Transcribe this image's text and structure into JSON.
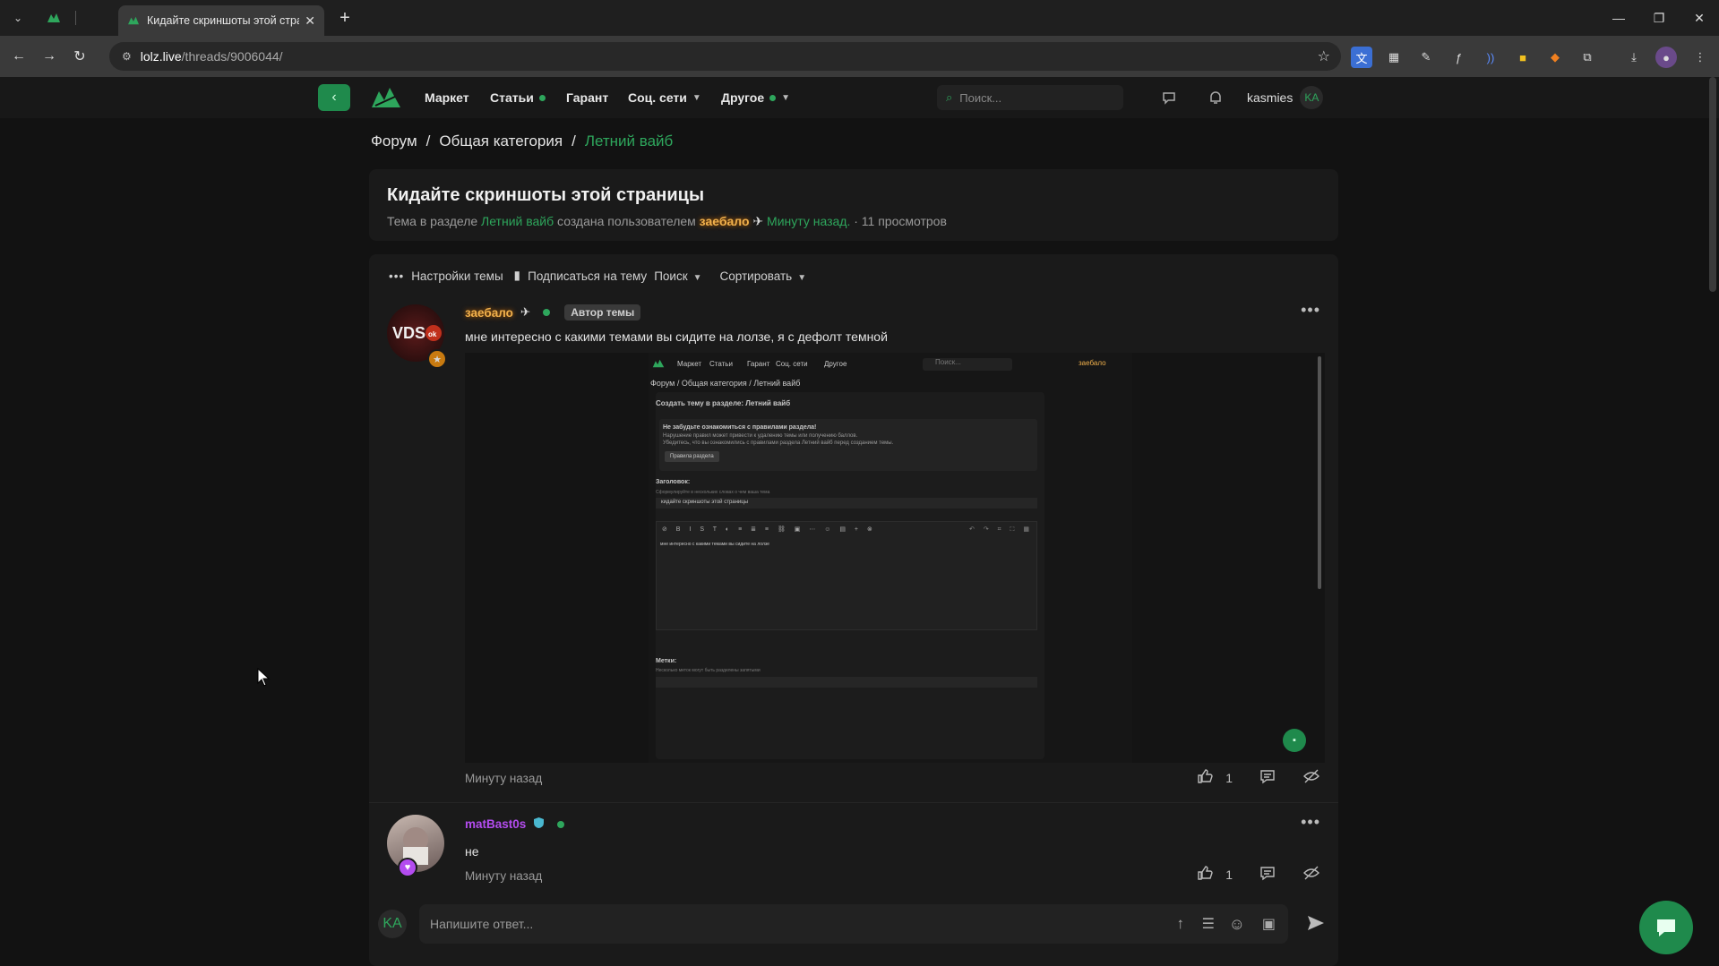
{
  "browser": {
    "tab_title": "Кидайте скриншоты этой стра",
    "url_host": "lolz.live",
    "url_path": "/threads/9006044/"
  },
  "header": {
    "nav": [
      {
        "label": "Маркет"
      },
      {
        "label": "Статьи"
      },
      {
        "label": "Гарант"
      },
      {
        "label": "Соц. сети"
      },
      {
        "label": "Другое"
      }
    ],
    "search_placeholder": "Поиск...",
    "username": "kasmies",
    "avatar_initials": "KA"
  },
  "breadcrumbs": [
    "Форум",
    "Общая категория",
    "Летний вайб"
  ],
  "thread": {
    "title": "Кидайте скриншоты этой страницы",
    "meta_prefix": "Тема в разделе",
    "section": "Летний вайб",
    "meta_mid": "создана пользователем",
    "author": "заебало",
    "time": "Минуту назад.",
    "views": "· 11 просмотров"
  },
  "toolbar": {
    "settings": "Настройки темы",
    "subscribe": "Подписаться на тему",
    "search": "Поиск",
    "sort": "Сортировать"
  },
  "posts": [
    {
      "author": "заебало",
      "tag": "Автор темы",
      "text": "мне интересно с какими темами вы сидите на лолзе, я с дефолт темной",
      "time": "Минуту назад",
      "likes": "1"
    },
    {
      "author": "matBast0s",
      "text": "не",
      "time": "Минуту назад",
      "likes": "1"
    }
  ],
  "screenshot": {
    "nav": [
      "Маркет",
      "Статьи",
      "Гарант",
      "Соц. сети",
      "Другое"
    ],
    "search": "Поиск...",
    "crumbs": "Форум / Общая категория / Летний вайб",
    "heading": "Создать тему в разделе: Летний вайб",
    "notice_title": "Не забудьте ознакомиться с правилами раздела!",
    "notice_l1": "Нарушение правил может привести к удалению темы или получению баллов.",
    "notice_l2": "Убедитесь, что вы ознакомились с правилами раздела Летний вайб перед созданием темы.",
    "rules_btn": "Правила раздела",
    "label_title": "Заголовок:",
    "title_hint": "Сформулируйте в нескольких словах о чем ваша тема",
    "title_value": "кидайте скриншоты этой страницы",
    "body": "мне интересно с какими темами вы сидите на лолзе",
    "label_tags": "Метки:",
    "tags_hint": "Несколько меток могут быть разделены запятыми"
  },
  "reply": {
    "avatar_initials": "KA",
    "placeholder": "Напишите ответ..."
  },
  "colors": {
    "accent": "#2ea65c",
    "gold": "#f0b04c",
    "purple": "#b44cf0"
  }
}
